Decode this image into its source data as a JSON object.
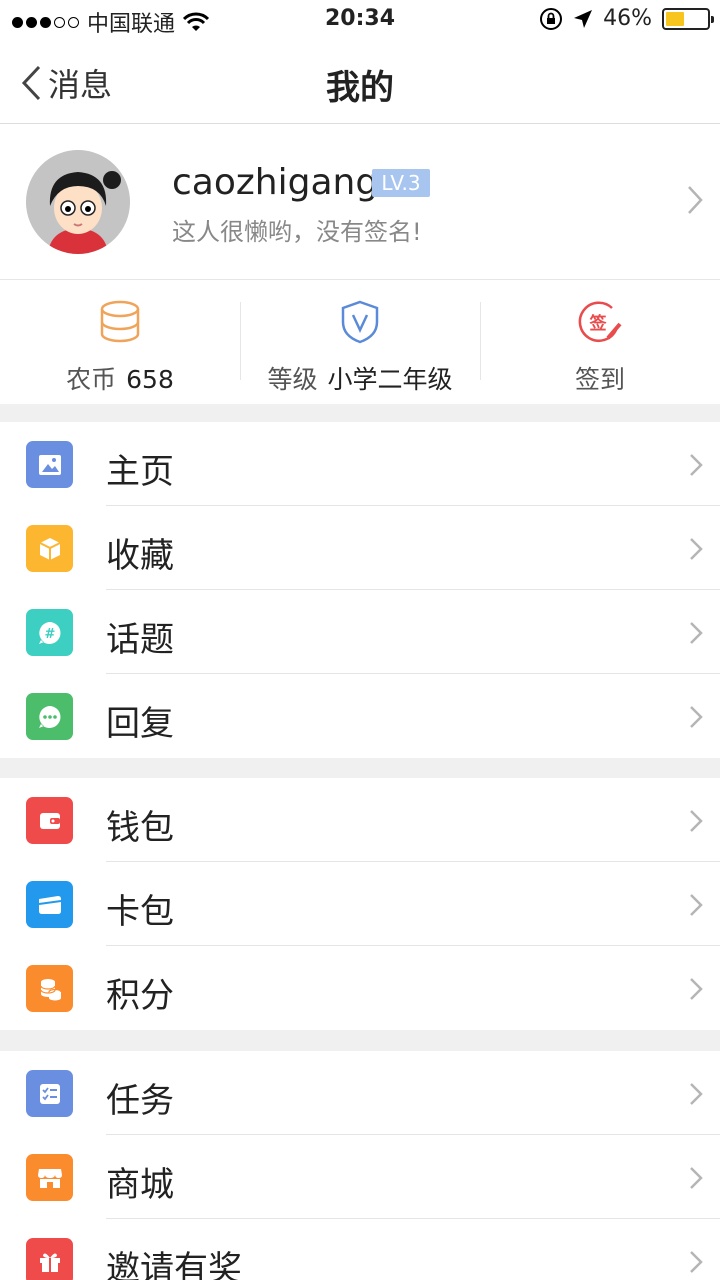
{
  "status_bar": {
    "carrier": "中国联通",
    "time": "20:34",
    "battery_percent": "46%",
    "battery_level": 0.46,
    "battery_color": "#f7c51e"
  },
  "nav": {
    "back_label": "消息",
    "title": "我的"
  },
  "profile": {
    "username": "caozhigang",
    "level_badge": "LV.3",
    "signature": "这人很懒哟，没有签名!"
  },
  "stats": {
    "coins_label": "农币",
    "coins_value": "658",
    "level_label": "等级",
    "level_value": "小学二年级",
    "checkin_label": "签到",
    "checkin_icon_text": "签"
  },
  "groups": [
    {
      "items": [
        {
          "label": "主页",
          "icon": "image-icon",
          "color": "#6b8fe0"
        },
        {
          "label": "收藏",
          "icon": "box-icon",
          "color": "#fcb630"
        },
        {
          "label": "话题",
          "icon": "hashtag-chat-icon",
          "color": "#3ccfc2"
        },
        {
          "label": "回复",
          "icon": "chat-bubble-icon",
          "color": "#4cbd6a"
        }
      ]
    },
    {
      "items": [
        {
          "label": "钱包",
          "icon": "wallet-icon",
          "color": "#f04b4b"
        },
        {
          "label": "卡包",
          "icon": "card-icon",
          "color": "#2399ee"
        },
        {
          "label": "积分",
          "icon": "coins-icon",
          "color": "#fb8c2e"
        }
      ]
    },
    {
      "items": [
        {
          "label": "任务",
          "icon": "checklist-icon",
          "color": "#6b8fe0"
        },
        {
          "label": "商城",
          "icon": "store-icon",
          "color": "#fb8c2e"
        },
        {
          "label": "邀请有奖",
          "icon": "gift-icon",
          "color": "#f04b4b"
        }
      ]
    }
  ]
}
